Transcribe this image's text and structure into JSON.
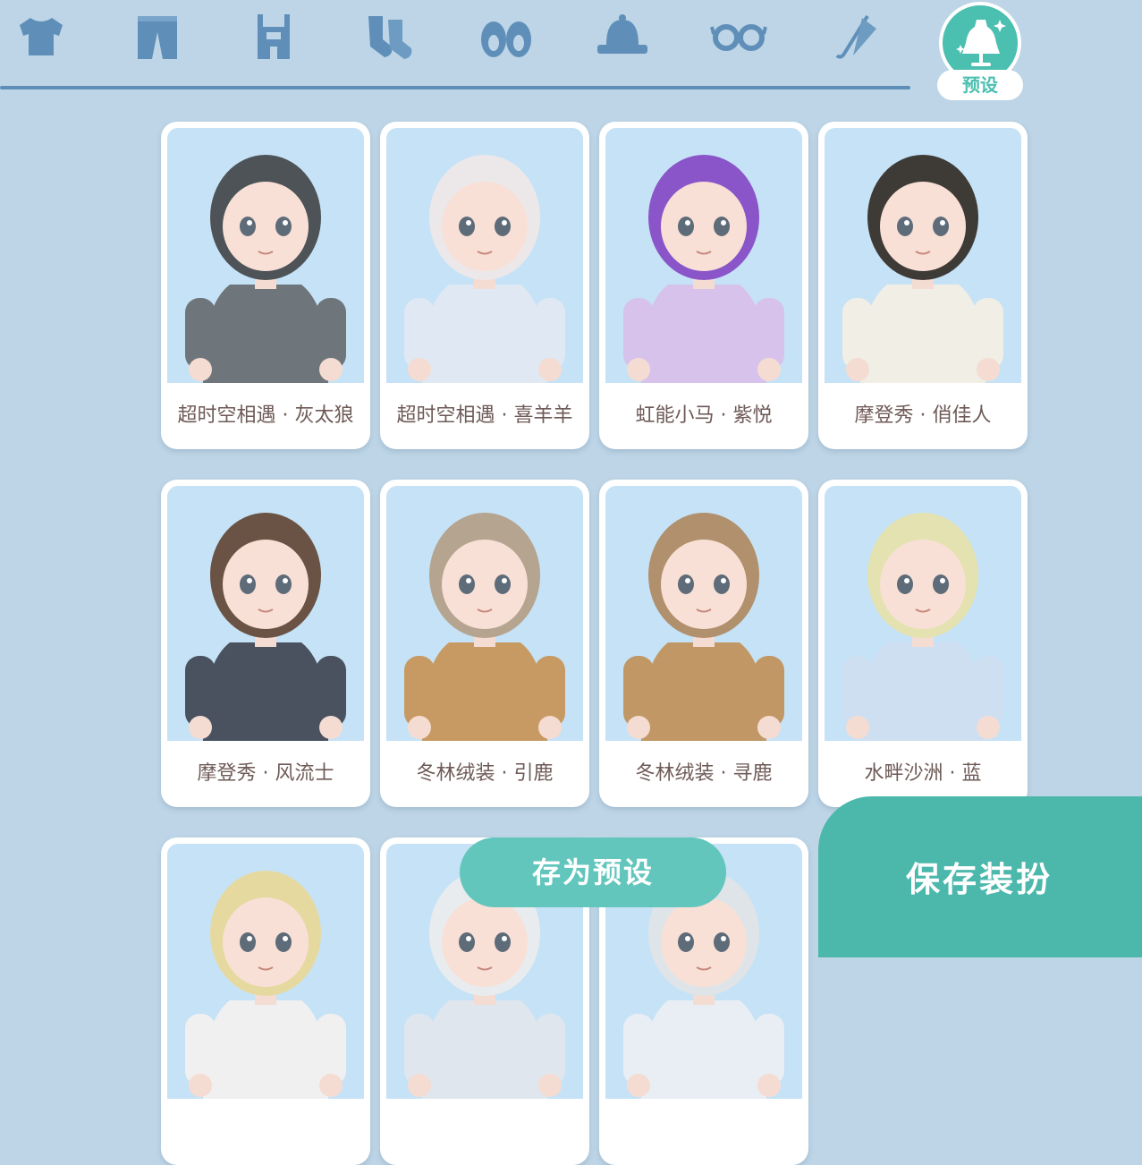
{
  "categories": [
    {
      "name": "tops",
      "icon": "tshirt-icon"
    },
    {
      "name": "bottoms",
      "icon": "pants-icon"
    },
    {
      "name": "overalls",
      "icon": "overalls-icon"
    },
    {
      "name": "socks",
      "icon": "socks-icon"
    },
    {
      "name": "shoes",
      "icon": "shoes-icon"
    },
    {
      "name": "hats",
      "icon": "hat-icon"
    },
    {
      "name": "glasses",
      "icon": "glasses-icon"
    },
    {
      "name": "umbrella",
      "icon": "umbrella-icon"
    }
  ],
  "preset_tab": {
    "label": "预设",
    "icon": "dress-mannequin-icon",
    "selected": true
  },
  "presets": [
    {
      "name": "超时空相遇 · 灰太狼",
      "hair": "#4d5356",
      "outfit": "#6e767c"
    },
    {
      "name": "超时空相遇 · 喜羊羊",
      "hair": "#ece8ea",
      "outfit": "#dfe8f3"
    },
    {
      "name": "虹能小马 · 紫悦",
      "hair": "#8a55c9",
      "outfit": "#d7c2ec"
    },
    {
      "name": "摩登秀 · 俏佳人",
      "hair": "#3e3a36",
      "outfit": "#f1eee6"
    },
    {
      "name": "摩登秀 · 风流士",
      "hair": "#6a5244",
      "outfit": "#4a5260"
    },
    {
      "name": "冬林绒装 · 引鹿",
      "hair": "#b5a48f",
      "outfit": "#c79a63"
    },
    {
      "name": "冬林绒装 · 寻鹿",
      "hair": "#b0906d",
      "outfit": "#c19865"
    },
    {
      "name": "水畔沙洲 · 蓝",
      "hair": "#e3e2b0",
      "outfit": "#cfdff2"
    },
    {
      "name": "",
      "hair": "#e6d9a0",
      "outfit": "#f0f0f0"
    },
    {
      "name": "",
      "hair": "#e8ecef",
      "outfit": "#dfe6ee"
    },
    {
      "name": "",
      "hair": "#dfe4e8",
      "outfit": "#e8eef3"
    }
  ],
  "buttons": {
    "save_preset": "存为预设",
    "save_outfit": "保存装扮"
  },
  "colors": {
    "accent": "#4bbfb0",
    "icon_blue": "#5f8fb8",
    "background": "#bdd5e6",
    "label_text": "#6e5a57"
  }
}
